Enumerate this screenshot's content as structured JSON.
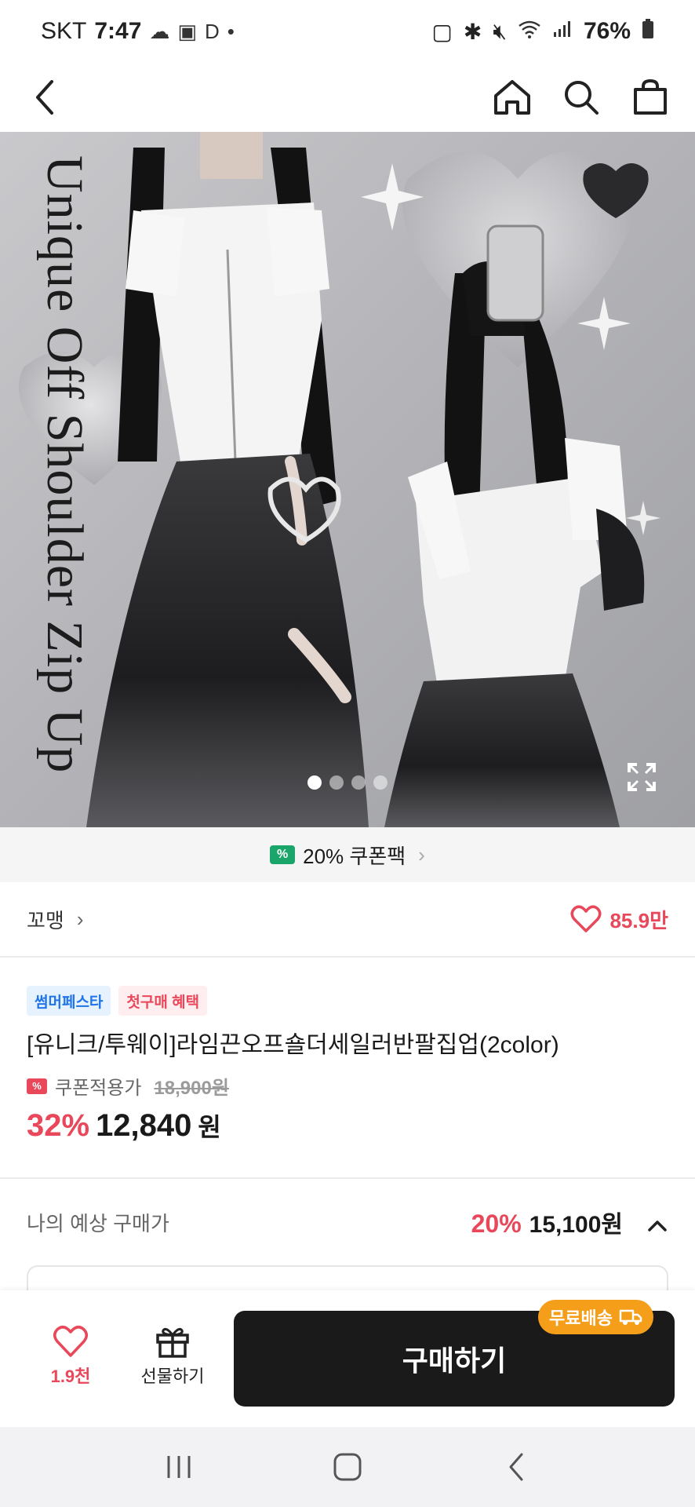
{
  "status_bar": {
    "carrier": "SKT",
    "time": "7:47",
    "extra_letter": "D",
    "battery": "76%"
  },
  "hero": {
    "overlay_text": "Unique Off Shoulder Zip Up",
    "slide_count": 4,
    "active_slide": 1
  },
  "coupon_pack": {
    "icon_text": "%",
    "label": "20% 쿠폰팩"
  },
  "store": {
    "name": "꼬맹",
    "like_count": "85.9만"
  },
  "product": {
    "badges": [
      "썸머페스타",
      "첫구매 혜택"
    ],
    "title": "[유니크/투웨이]라임끈오프숄더세일러반팔집업(2color)",
    "coupon_icon_text": "%",
    "price_label": "쿠폰적용가",
    "original_price": "18,900원",
    "discount": "32%",
    "final_price": "12,840",
    "currency": "원"
  },
  "expected_price": {
    "label": "나의 예상 구매가",
    "discount": "20%",
    "price": "15,100원"
  },
  "bottom_bar": {
    "like_count": "1.9천",
    "gift_label": "선물하기",
    "buy_label": "구매하기",
    "free_shipping_label": "무료배송"
  },
  "colors": {
    "accent": "#e8485a",
    "coupon_green": "#1aa56a",
    "buy_button": "#1a1a1a",
    "free_shipping": "#f59e1a"
  }
}
